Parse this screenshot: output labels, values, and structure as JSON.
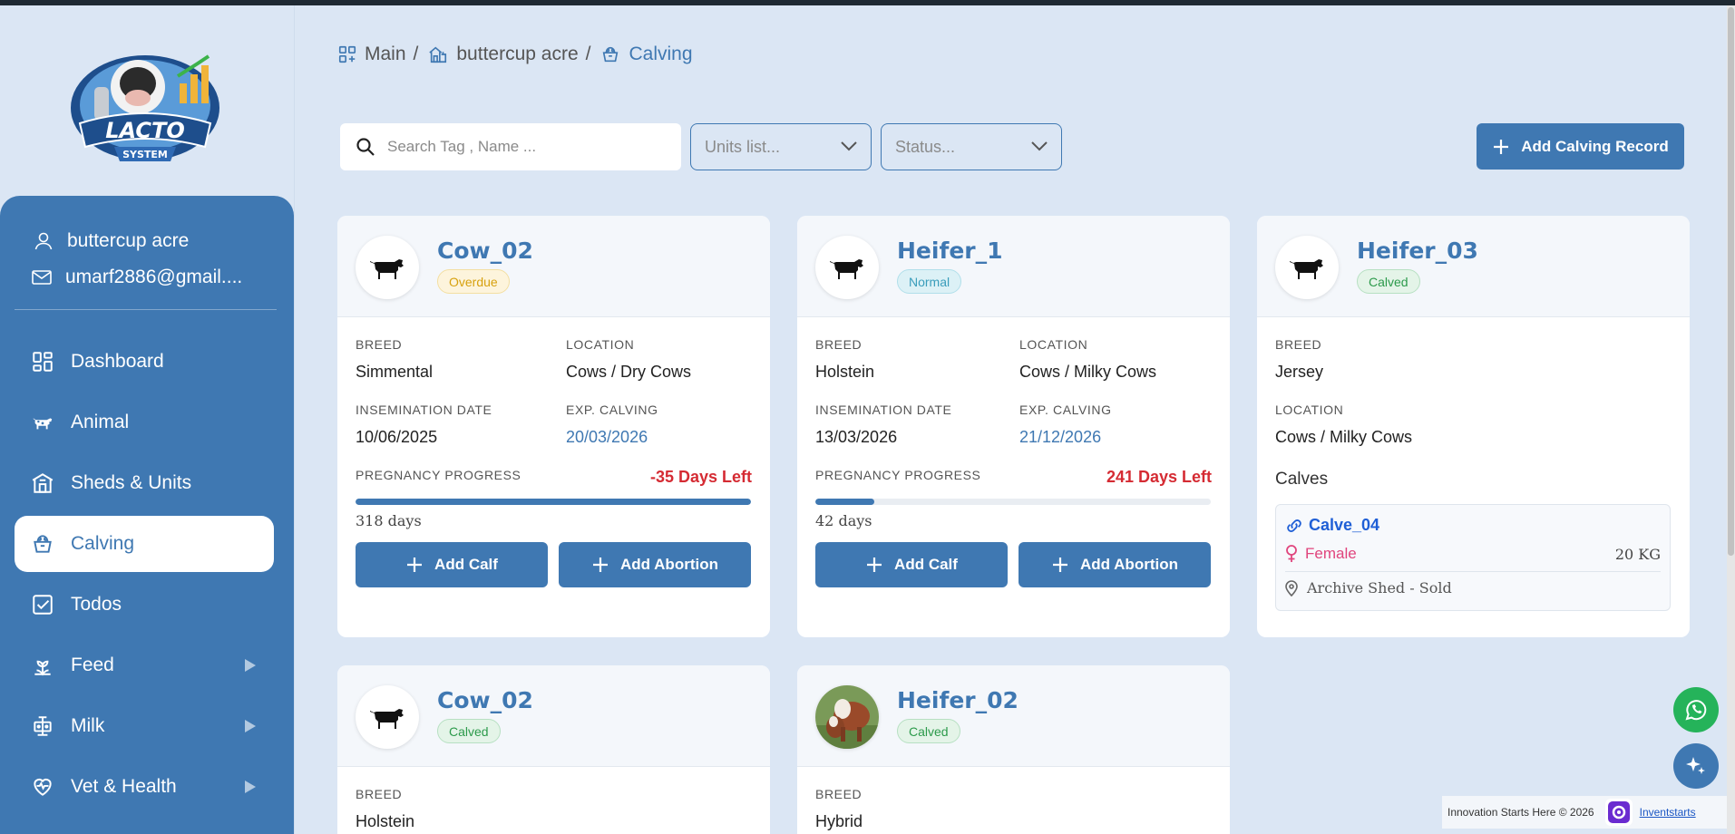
{
  "brand": {
    "logo_line1": "LACTO",
    "logo_line2": "SYSTEM"
  },
  "user": {
    "name": "buttercup acre",
    "email": "umarf2886@gmail...."
  },
  "nav": [
    {
      "label": "Dashboard",
      "icon": "grid-icon"
    },
    {
      "label": "Animal",
      "icon": "cow-icon"
    },
    {
      "label": "Sheds & Units",
      "icon": "shed-icon"
    },
    {
      "label": "Calving",
      "icon": "calving-icon",
      "active": true
    },
    {
      "label": "Todos",
      "icon": "checkbox-icon"
    },
    {
      "label": "Feed",
      "icon": "feed-icon",
      "has_submenu": true
    },
    {
      "label": "Milk",
      "icon": "milk-icon",
      "has_submenu": true
    },
    {
      "label": "Vet & Health",
      "icon": "heart-icon",
      "has_submenu": true
    }
  ],
  "breadcrumb": [
    {
      "label": "Main",
      "sep": "/"
    },
    {
      "label": "buttercup acre",
      "sep": "/"
    },
    {
      "label": "Calving"
    }
  ],
  "filters": {
    "search_placeholder": "Search Tag , Name ...",
    "units_placeholder": "Units list...",
    "status_placeholder": "Status..."
  },
  "actions": {
    "add_calving_record": "Add Calving Record"
  },
  "labels": {
    "breed": "BREED",
    "location": "LOCATION",
    "insemination_date": "INSEMINATION DATE",
    "exp_calving": "EXP. CALVING",
    "pregnancy_progress": "PREGNANCY PROGRESS",
    "add_calf": "Add Calf",
    "add_abortion": "Add Abortion",
    "calves": "Calves"
  },
  "cards": [
    {
      "name": "Cow_02",
      "status": "Overdue",
      "breed": "Simmental",
      "location": "Cows / Dry Cows",
      "insemination_date": "10/06/2025",
      "exp_calving": "20/03/2026",
      "days_left": "-35 Days Left",
      "days_elapsed": "318 days",
      "progress_fraction": 1.0
    },
    {
      "name": "Heifer_1",
      "status": "Normal",
      "breed": "Holstein",
      "location": "Cows / Milky Cows",
      "insemination_date": "13/03/2026",
      "exp_calving": "21/12/2026",
      "days_left": "241 Days Left",
      "days_elapsed": "42 days",
      "progress_fraction": 0.148
    },
    {
      "name": "Heifer_03",
      "status": "Calved",
      "breed": "Jersey",
      "location": "Cows / Milky Cows",
      "calves": [
        {
          "name": "Calve_04",
          "sex": "Female",
          "weight": "20 KG",
          "location": "Archive Shed - Sold"
        }
      ]
    },
    {
      "name": "Cow_02",
      "status": "Calved",
      "breed": "Holstein"
    },
    {
      "name": "Heifer_02",
      "status": "Calved",
      "breed": "Hybrid"
    }
  ],
  "footer": {
    "tagline": "Innovation Starts Here © 2026",
    "link": "Inventstarts"
  },
  "colors": {
    "accent": "#3f78b2",
    "background": "#dbe6f4",
    "danger": "#d52b33",
    "overdue": "#d7a10f",
    "normal": "#3a9dbb",
    "calved": "#2c9a4b"
  }
}
